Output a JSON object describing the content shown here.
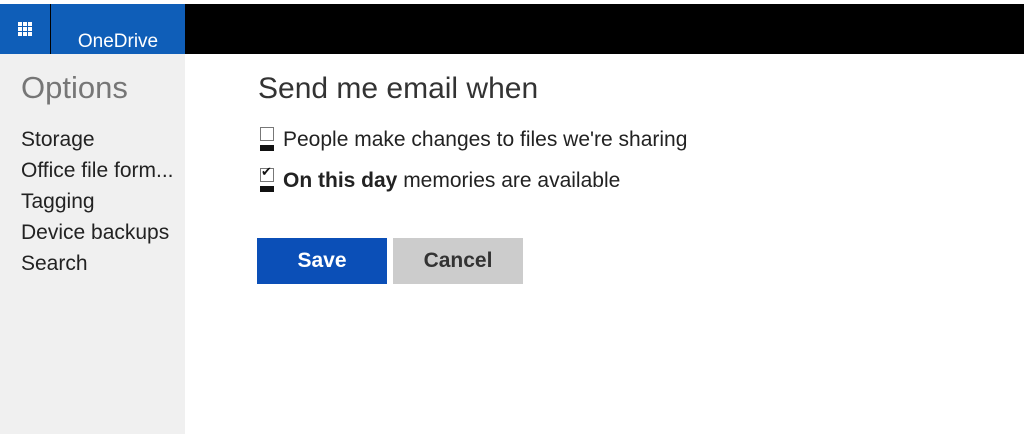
{
  "header": {
    "brand": "OneDrive",
    "app_launcher_icon": "waffle-grid-icon",
    "brand_color": "#0f5eb8"
  },
  "sidebar": {
    "title": "Options",
    "items": [
      {
        "label": "Storage"
      },
      {
        "label": "Office file form..."
      },
      {
        "label": "Tagging"
      },
      {
        "label": "Device backups"
      },
      {
        "label": "Search"
      }
    ]
  },
  "main": {
    "title": "Send me email when",
    "options": [
      {
        "label": "People make changes to files we're sharing",
        "checked": false
      },
      {
        "bold_label": "On this day",
        "label": " memories are available",
        "checked": true
      }
    ],
    "save_label": "Save",
    "cancel_label": "Cancel",
    "save_color": "#0b4fb7",
    "cancel_color": "#cccccc"
  }
}
